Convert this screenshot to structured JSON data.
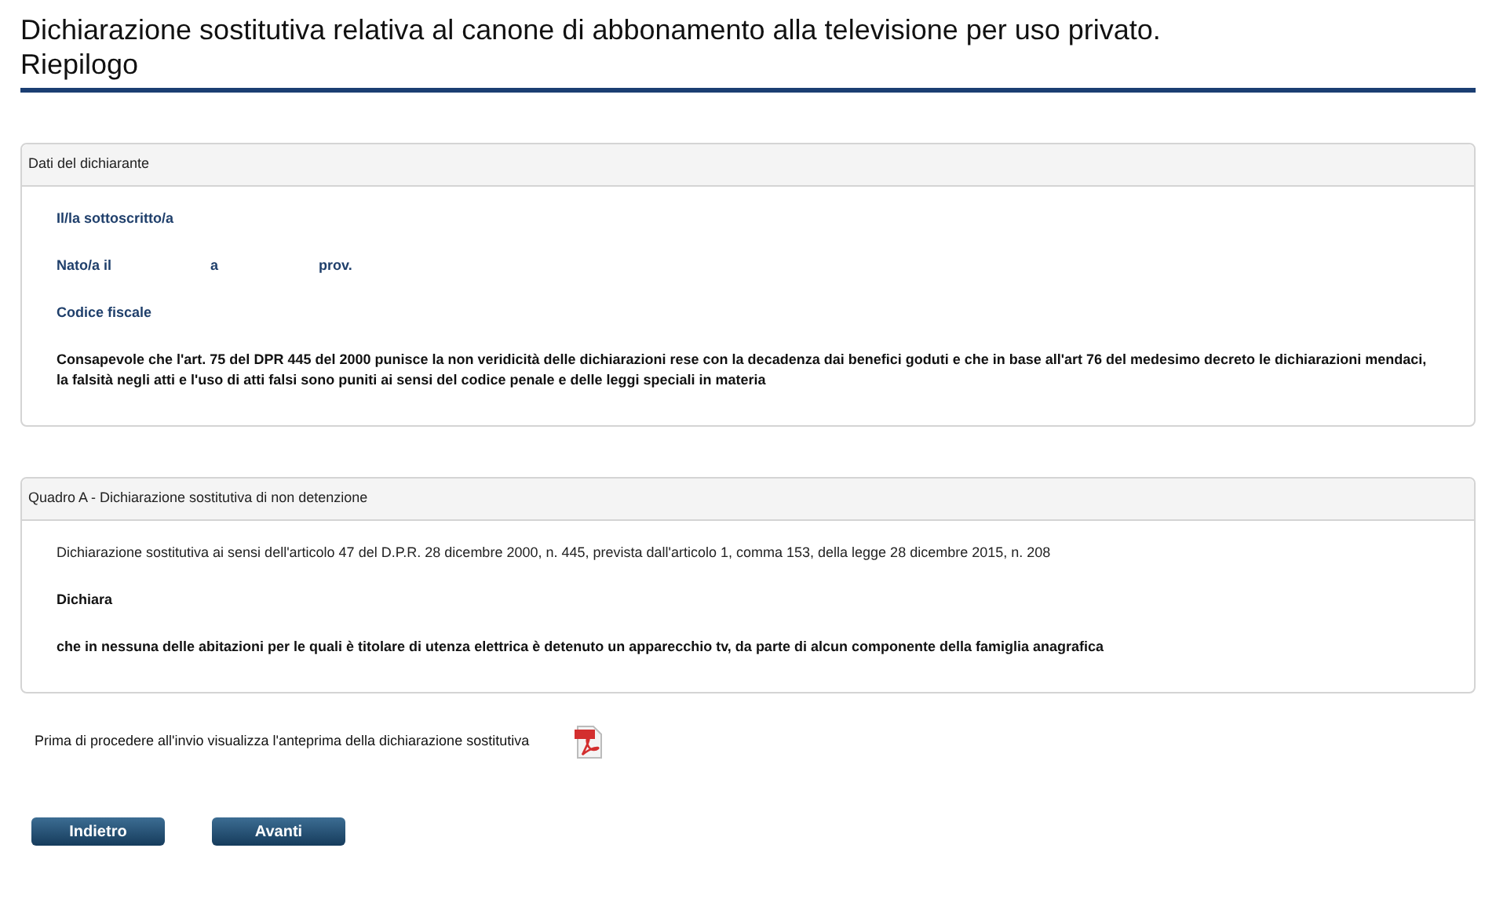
{
  "title": [
    "Dichiarazione sostitutiva relativa al canone di abbonamento alla televisione per uso privato.",
    "Riepilogo"
  ],
  "panels": [
    {
      "heading": "Dati del dichiarante",
      "rows": [
        {
          "kind": "label",
          "texts": [
            "Il/la sottoscritto/a"
          ]
        },
        {
          "kind": "label",
          "texts": [
            "Nato/a il",
            "a",
            "prov."
          ]
        },
        {
          "kind": "label",
          "texts": [
            "Codice fiscale"
          ]
        },
        {
          "kind": "statement",
          "texts": [
            "Consapevole che l'art. 75 del DPR 445 del 2000 punisce la non veridicità delle dichiarazioni rese con la decadenza dai benefici goduti e che in base all'art 76 del medesimo decreto le dichiarazioni mendaci, la falsità negli atti e l'uso di atti falsi sono puniti ai sensi del codice penale e delle leggi speciali in materia"
          ]
        }
      ]
    },
    {
      "heading": "Quadro A - Dichiarazione sostitutiva di non detenzione",
      "rows": [
        {
          "kind": "plain",
          "texts": [
            "Dichiarazione sostitutiva ai sensi dell'articolo 47 del D.P.R. 28 dicembre 2000, n. 445, prevista dall'articolo 1, comma 153, della legge 28 dicembre 2015, n. 208"
          ]
        },
        {
          "kind": "statement",
          "texts": [
            "Dichiara"
          ]
        },
        {
          "kind": "statement",
          "texts": [
            "che in nessuna delle abitazioni per le quali è titolare di utenza elettrica è detenuto un apparecchio tv, da parte di alcun componente della famiglia anagrafica"
          ]
        }
      ]
    }
  ],
  "preview": {
    "text": "Prima di procedere all'invio visualizza l'anteprima della dichiarazione sostitutiva"
  },
  "buttons": [
    "Indietro",
    "Avanti"
  ]
}
